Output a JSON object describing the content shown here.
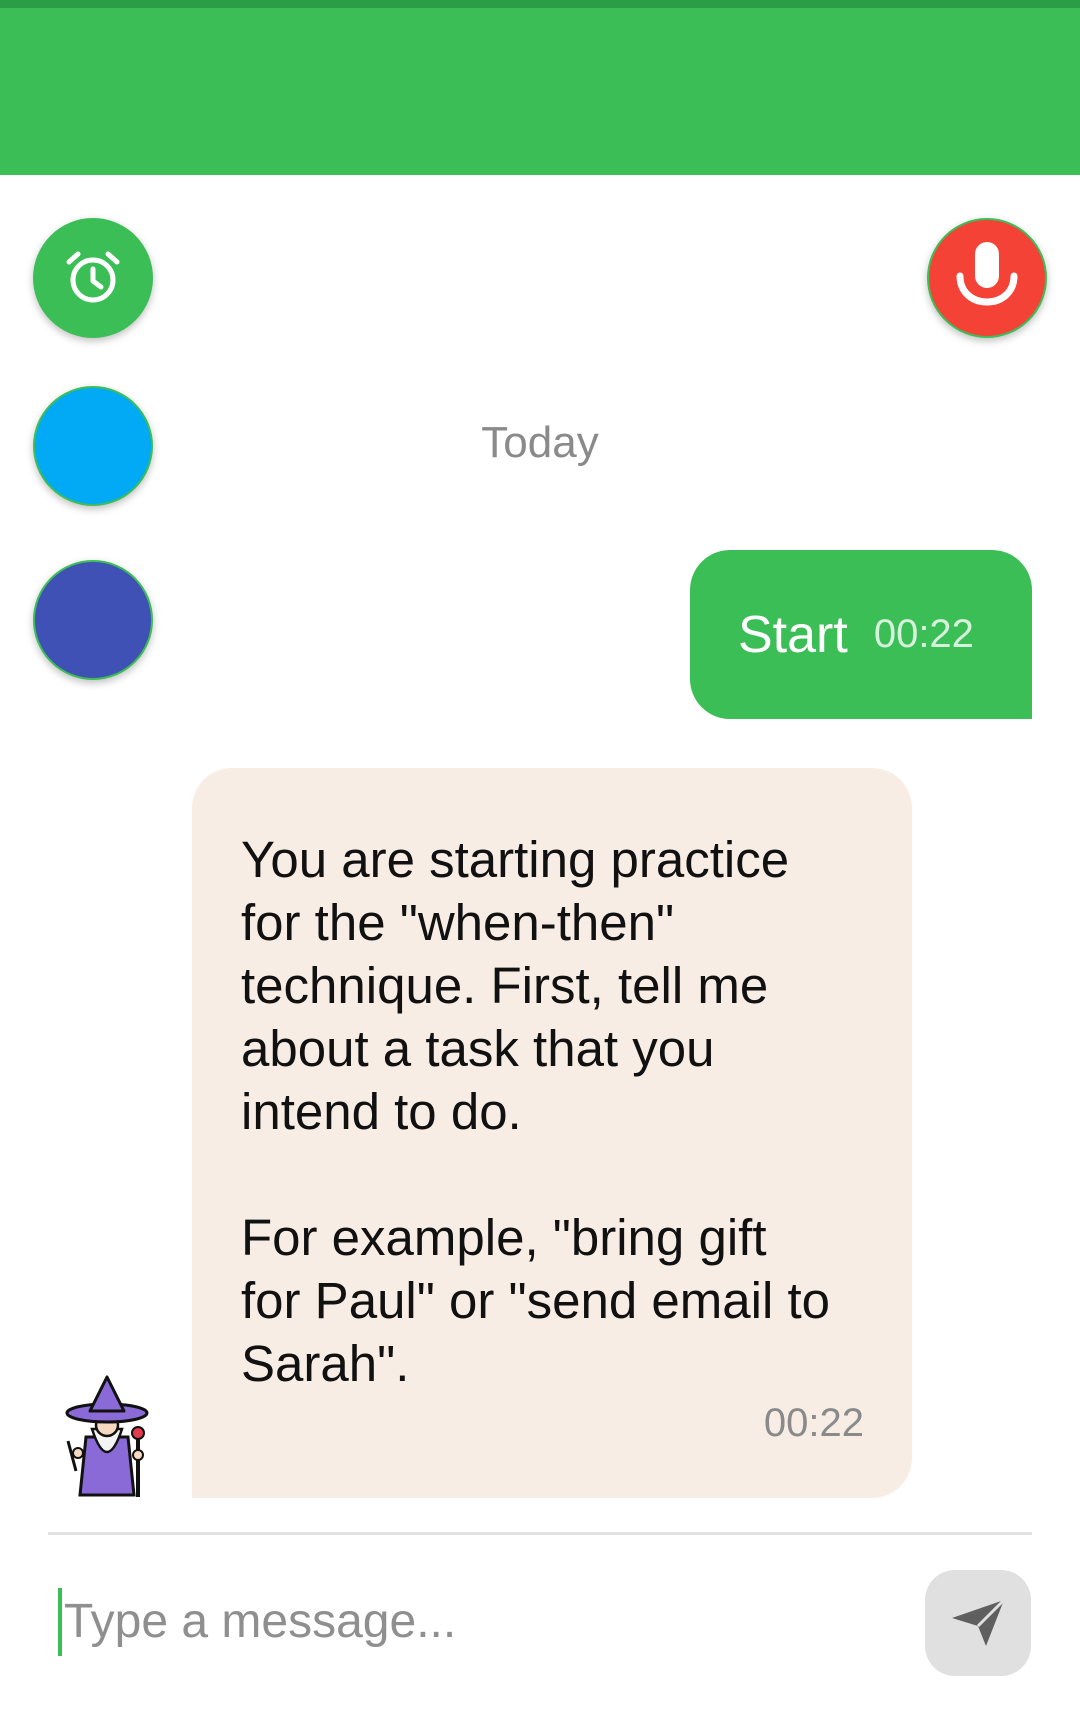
{
  "colors": {
    "primary": "#3cbe57",
    "mic": "#f44336",
    "blue_fab": "#02a9f4",
    "indigo_fab": "#3f51b5",
    "incoming_bubble": "#f7ede4"
  },
  "fabs": [
    {
      "icon": "alarm-clock-icon"
    },
    {
      "icon": "none"
    },
    {
      "icon": "none"
    },
    {
      "icon": "microphone-icon"
    }
  ],
  "chat": {
    "date_separator": "Today",
    "messages": [
      {
        "direction": "outgoing",
        "text": "Start",
        "time": "00:22"
      },
      {
        "direction": "incoming",
        "avatar": "wizard-avatar",
        "text": "You are starting practice\nfor the \"when-then\"\ntechnique. First, tell me\nabout a task that you\nintend to do.\n\nFor example, \"bring gift\nfor Paul\" or \"send email to\nSarah\".",
        "time": "00:22"
      }
    ]
  },
  "composer": {
    "placeholder": "Type a message...",
    "value": "",
    "send_icon": "send-icon"
  }
}
